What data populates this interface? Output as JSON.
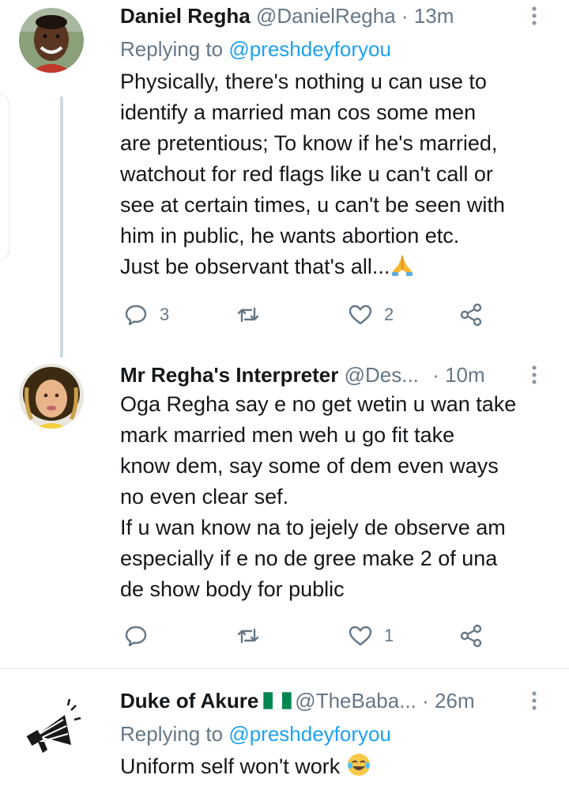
{
  "colors": {
    "link": "#1da1f2",
    "muted": "#657786",
    "text": "#14171a",
    "divider": "#e1e8ed"
  },
  "tweets": [
    {
      "name": "Daniel Regha",
      "handle": "@DanielRegha",
      "dot": "·",
      "time": "13m",
      "replying_prefix": "Replying to",
      "replying_to": "@preshdeyforyou",
      "text": "Physically, there's nothing u can use to\nidentify a married man cos some men\nare pretentious; To know if he's married,\nwatchout for red flags like u can't call or\nsee at certain times, u can't be seen with\nhim in public, he wants abortion etc.\nJust be observant that's all...",
      "emoji": "folded-hands-emoji",
      "reply_count": "3",
      "retweet_count": "",
      "like_count": "2"
    },
    {
      "name": "Mr Regha's Interpreter",
      "handle": "@Des...",
      "dot": "·",
      "time": "10m",
      "text": "Oga Regha say e no get wetin u wan take\nmark married men weh u go fit take\nknow dem, say some of dem even ways\nno even clear sef.\nIf u wan know na to jejely de observe am\nespecially if e no de gree make 2 of una\nde show body for public",
      "reply_count": "",
      "retweet_count": "",
      "like_count": "1"
    },
    {
      "name": "Duke of Akure",
      "flag": "nigeria-flag",
      "handle": "@TheBaba...",
      "dot": "·",
      "time": "26m",
      "replying_prefix": "Replying to",
      "replying_to": "@preshdeyforyou",
      "text": "Uniform self won't work",
      "emoji": "tears-of-joy-emoji"
    }
  ],
  "icons": {
    "reply": "reply-icon",
    "retweet": "retweet-icon",
    "like": "heart-icon",
    "share": "share-icon",
    "more": "more-vertical-icon"
  }
}
